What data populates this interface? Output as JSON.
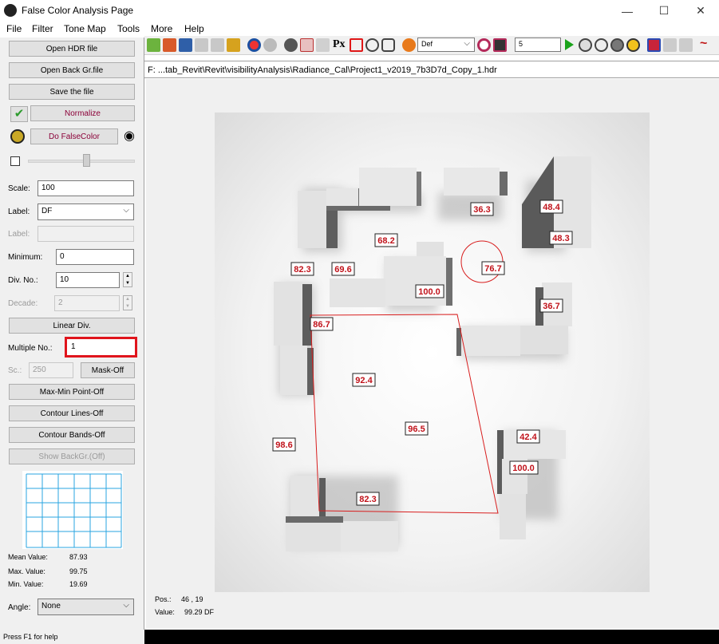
{
  "window": {
    "title": "False Color Analysis Page",
    "minimize": "—",
    "maximize": "☐",
    "close": "✕"
  },
  "menu": [
    "File",
    "Filter",
    "Tone Map",
    "Tools",
    "More",
    "Help"
  ],
  "left_panel": {
    "open_hdr": "Open HDR file",
    "open_back": "Open Back Gr.file",
    "save": "Save the file",
    "normalize": "Normalize",
    "do_falsecolor": "Do FalseColor",
    "scale_label": "Scale:",
    "scale_value": "100",
    "label_label": "Label:",
    "label_value": "DF",
    "label2_label": "Label:",
    "minimum_label": "Minimum:",
    "minimum_value": "0",
    "divno_label": "Div. No.:",
    "divno_value": "10",
    "decade_label": "Decade:",
    "decade_value": "2",
    "linear_div": "Linear Div.",
    "multiple_label": "Multiple No.:",
    "multiple_value": "1",
    "sc_label": "Sc.:",
    "sc_value": "250",
    "mask": "Mask-Off",
    "maxmin": "Max-Min Point-Off",
    "contour_lines": "Contour Lines-Off",
    "contour_bands": "Contour Bands-Off",
    "show_backgr": "Show BackGr.(Off)",
    "mean_label": "Mean Value:",
    "mean_value": "87.93",
    "max_label": "Max. Value:",
    "max_value": "99.75",
    "min_label": "Min. Value:",
    "min_value": "19.69",
    "angle_label": "Angle:",
    "angle_value": "None"
  },
  "toolbar": {
    "combo_value": "Def",
    "number_value": "5",
    "px_label": "Px"
  },
  "path": "F:  ...tab_Revit\\Revit\\visibilityAnalysis\\Radiance_Cal\\Project1_v2019_7b3D7d_Copy_1.hdr",
  "readout": {
    "pos_label": "Pos.:",
    "pos_value": "46 , 19",
    "value_label": "Value:",
    "value_value": "99.29 DF"
  },
  "status": "Press F1 for help",
  "data_labels": [
    "36.3",
    "48.4",
    "48.3",
    "68.2",
    "76.7",
    "82.3",
    "69.6",
    "100.0",
    "36.7",
    "86.7",
    "92.4",
    "96.5",
    "98.6",
    "42.4",
    "100.0",
    "82.3"
  ]
}
